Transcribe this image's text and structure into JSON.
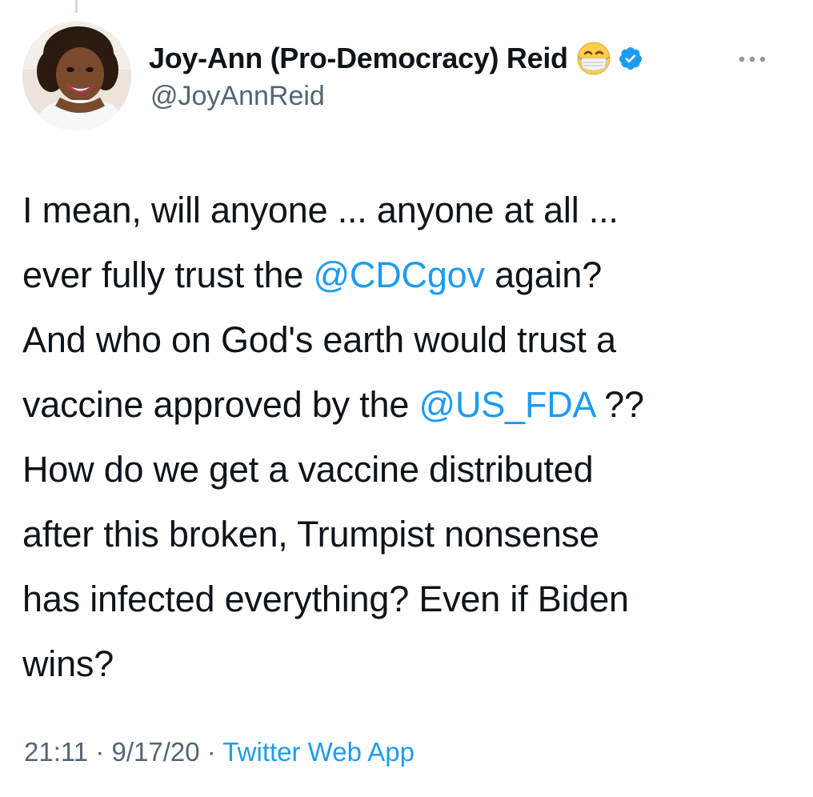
{
  "author": {
    "display_name": "Joy-Ann (Pro-Democracy) Reid",
    "handle": "@JoyAnnReid",
    "name_emoji": "face-with-medical-mask-icon",
    "verified": true
  },
  "tweet": {
    "lines": [
      {
        "parts": [
          {
            "text": "I mean, will anyone ... anyone at all ..."
          }
        ]
      },
      {
        "parts": [
          {
            "text": "ever fully trust the "
          },
          {
            "text": "@CDCgov",
            "mention": true
          },
          {
            "text": " again?"
          }
        ]
      },
      {
        "parts": [
          {
            "text": "And who on God's earth would trust a"
          }
        ]
      },
      {
        "parts": [
          {
            "text": "vaccine approved by the "
          },
          {
            "text": "@US_FDA",
            "mention": true
          },
          {
            "text": " ??"
          }
        ]
      },
      {
        "parts": [
          {
            "text": "How do we get a vaccine distributed"
          }
        ]
      },
      {
        "parts": [
          {
            "text": "after this broken, Trumpist nonsense"
          }
        ]
      },
      {
        "parts": [
          {
            "text": "has infected everything? Even if Biden"
          }
        ]
      },
      {
        "parts": [
          {
            "text": "wins?"
          }
        ]
      }
    ]
  },
  "meta": {
    "time": "21:11",
    "separator": " · ",
    "date": "9/17/20",
    "source": "Twitter Web App"
  },
  "colors": {
    "text": "#0f1419",
    "secondary": "#536471",
    "link": "#1d9bf0"
  },
  "icons": {
    "more": "more-horizontal-icon",
    "verified": "verified-badge-icon"
  }
}
